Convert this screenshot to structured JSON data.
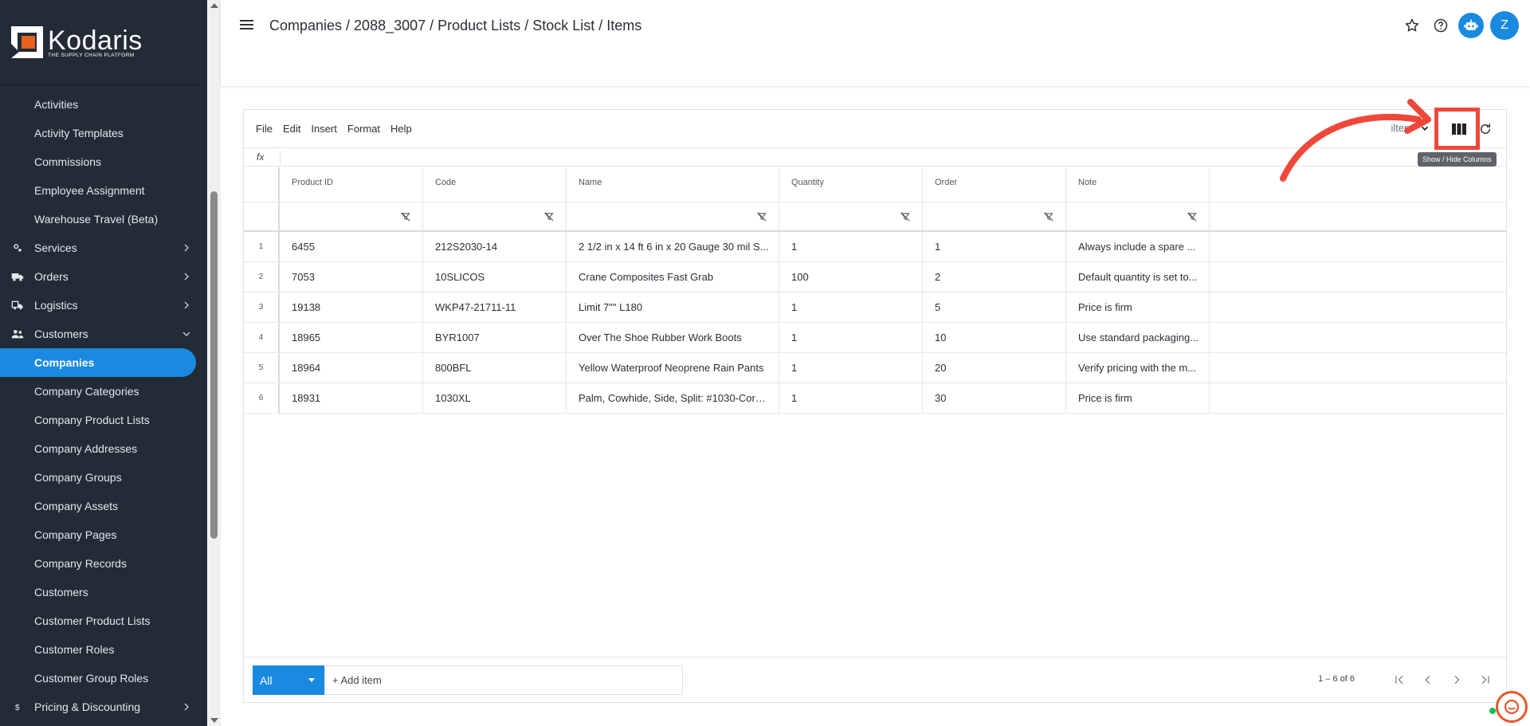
{
  "app": {
    "brand_name": "Kodaris",
    "brand_tagline": "THE SUPPLY CHAIN PLATFORM",
    "accent_color": "#1a8ae0",
    "sidebar_bg": "#222b36"
  },
  "sidebar": {
    "items": [
      {
        "label": "Activities",
        "type": "child"
      },
      {
        "label": "Activity Templates",
        "type": "child"
      },
      {
        "label": "Commissions",
        "type": "child"
      },
      {
        "label": "Employee Assignment",
        "type": "child"
      },
      {
        "label": "Warehouse Travel (Beta)",
        "type": "child"
      },
      {
        "label": "Services",
        "type": "group",
        "icon": "services-icon",
        "expanded": false
      },
      {
        "label": "Orders",
        "type": "group",
        "icon": "truck-icon",
        "expanded": false
      },
      {
        "label": "Logistics",
        "type": "group",
        "icon": "logistics-icon",
        "expanded": false
      },
      {
        "label": "Customers",
        "type": "group",
        "icon": "people-icon",
        "expanded": true
      },
      {
        "label": "Companies",
        "type": "child",
        "active": true
      },
      {
        "label": "Company Categories",
        "type": "child"
      },
      {
        "label": "Company Product Lists",
        "type": "child"
      },
      {
        "label": "Company Addresses",
        "type": "child"
      },
      {
        "label": "Company Groups",
        "type": "child"
      },
      {
        "label": "Company Assets",
        "type": "child"
      },
      {
        "label": "Company Pages",
        "type": "child"
      },
      {
        "label": "Company Records",
        "type": "child"
      },
      {
        "label": "Customers",
        "type": "child"
      },
      {
        "label": "Customer Product Lists",
        "type": "child"
      },
      {
        "label": "Customer Roles",
        "type": "child"
      },
      {
        "label": "Customer Group Roles",
        "type": "child"
      },
      {
        "label": "Pricing & Discounting",
        "type": "group",
        "icon": "dollar-icon",
        "expanded": false
      }
    ]
  },
  "header": {
    "breadcrumb": "Companies / 2088_3007 / Product Lists / Stock List / Items",
    "avatar_initial": "Z"
  },
  "toolbar": {
    "menu": [
      "File",
      "Edit",
      "Insert",
      "Format",
      "Help"
    ],
    "filters_label": "ilters",
    "fx_label": "fx",
    "columns_tooltip": "Show / Hide Columns"
  },
  "grid": {
    "columns": [
      "Product ID",
      "Code",
      "Name",
      "Quantity",
      "Order",
      "Note"
    ],
    "rows": [
      {
        "idx": "1",
        "pid": "6455",
        "code": "212S2030-14",
        "name": "2 1/2 in x 14 ft 6 in x 20 Gauge 30 mil S...",
        "qty": "1",
        "order": "1",
        "note": "Always include a spare ..."
      },
      {
        "idx": "2",
        "pid": "7053",
        "code": "10SLICOS",
        "name": "Crane Composites Fast Grab",
        "qty": "100",
        "order": "2",
        "note": "Default quantity is set to..."
      },
      {
        "idx": "3",
        "pid": "19138",
        "code": "WKP47-21711-11",
        "name": "Limit 7\"\" L180",
        "qty": "1",
        "order": "5",
        "note": "Price is firm"
      },
      {
        "idx": "4",
        "pid": "18965",
        "code": "BYR1007",
        "name": "Over The Shoe Rubber Work Boots",
        "qty": "1",
        "order": "10",
        "note": "Use standard packaging..."
      },
      {
        "idx": "5",
        "pid": "18964",
        "code": "800BFL",
        "name": "Yellow Waterproof Neoprene Rain Pants",
        "qty": "1",
        "order": "20",
        "note": "Verify pricing with the m..."
      },
      {
        "idx": "6",
        "pid": "18931",
        "code": "1030XL",
        "name": "Palm, Cowhide, Side, Split: #1030-Cord...",
        "qty": "1",
        "order": "30",
        "note": "Price is firm"
      }
    ]
  },
  "footer": {
    "select_label": "All",
    "add_item_label": "+ Add item",
    "paging": "1 – 6 of 6"
  }
}
